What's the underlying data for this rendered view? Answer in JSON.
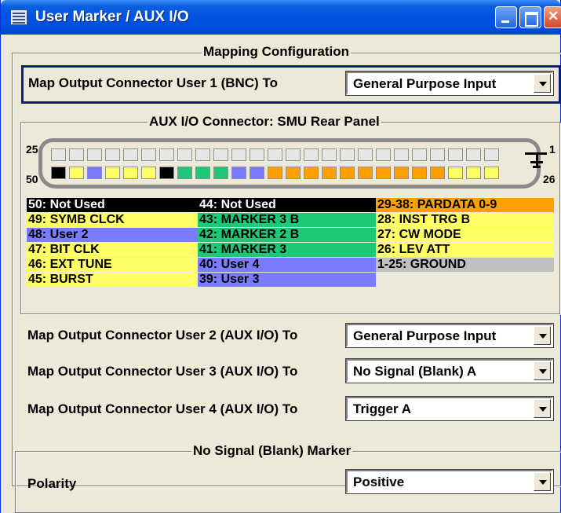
{
  "window": {
    "title": "User Marker / AUX I/O"
  },
  "mapping": {
    "group_title": "Mapping Configuration",
    "user1_label": "Map Output Connector User 1 (BNC) To",
    "user1_value": "General Purpose Input"
  },
  "aux": {
    "group_title": "AUX I/O Connector: SMU Rear Panel",
    "pin_labels": {
      "top_left": "25",
      "top_right": "1",
      "bottom_left": "50",
      "bottom_right": "26"
    },
    "top_row_colors": [
      "#e6e6e6",
      "#e6e6e6",
      "#e6e6e6",
      "#e6e6e6",
      "#e6e6e6",
      "#e6e6e6",
      "#e6e6e6",
      "#e6e6e6",
      "#e6e6e6",
      "#e6e6e6",
      "#e6e6e6",
      "#e6e6e6",
      "#e6e6e6",
      "#e6e6e6",
      "#e6e6e6",
      "#e6e6e6",
      "#e6e6e6",
      "#e6e6e6",
      "#e6e6e6",
      "#e6e6e6",
      "#e6e6e6",
      "#e6e6e6",
      "#e6e6e6",
      "#e6e6e6",
      "#e6e6e6"
    ],
    "bottom_row_colors": [
      "#000000",
      "#ffff66",
      "#7b7bff",
      "#ffff66",
      "#ffff66",
      "#ffff66",
      "#000000",
      "#1ec877",
      "#1ec877",
      "#1ec877",
      "#7b7bff",
      "#7b7bff",
      "#ff9f00",
      "#ff9f00",
      "#ff9f00",
      "#ff9f00",
      "#ff9f00",
      "#ff9f00",
      "#ff9f00",
      "#ff9f00",
      "#ff9f00",
      "#ff9f00",
      "#ffff66",
      "#ffff66",
      "#ffff66"
    ],
    "legend": [
      [
        {
          "text": "50: Not Used",
          "bg": "#000000",
          "fg": "#ffffff"
        },
        {
          "text": "44: Not Used",
          "bg": "#000000",
          "fg": "#ffffff"
        },
        {
          "text": "29-38: PARDATA 0-9",
          "bg": "#ff9f00",
          "fg": "#000000"
        }
      ],
      [
        {
          "text": "49: SYMB CLCK",
          "bg": "#ffff66",
          "fg": "#000000"
        },
        {
          "text": "43: MARKER 3 B",
          "bg": "#1ec877",
          "fg": "#000000"
        },
        {
          "text": "28: INST TRG B",
          "bg": "#ffff66",
          "fg": "#000000"
        }
      ],
      [
        {
          "text": "48: User 2",
          "bg": "#7b7bff",
          "fg": "#000000"
        },
        {
          "text": "42: MARKER 2 B",
          "bg": "#1ec877",
          "fg": "#000000"
        },
        {
          "text": "27: CW MODE",
          "bg": "#ffff66",
          "fg": "#000000"
        }
      ],
      [
        {
          "text": "47: BIT CLK",
          "bg": "#ffff66",
          "fg": "#000000"
        },
        {
          "text": "41: MARKER 3",
          "bg": "#1ec877",
          "fg": "#000000"
        },
        {
          "text": "26: LEV ATT",
          "bg": "#ffff66",
          "fg": "#000000"
        }
      ],
      [
        {
          "text": "46: EXT TUNE",
          "bg": "#ffff66",
          "fg": "#000000"
        },
        {
          "text": "40: User 4",
          "bg": "#7b7bff",
          "fg": "#000000"
        },
        {
          "text": "1-25: GROUND",
          "bg": "#c0c0c0",
          "fg": "#000000"
        }
      ],
      [
        {
          "text": "45: BURST",
          "bg": "#ffff66",
          "fg": "#000000"
        },
        {
          "text": "39: User 3",
          "bg": "#7b7bff",
          "fg": "#000000"
        },
        {
          "text": "",
          "bg": "#ece9d8",
          "fg": "#000000"
        }
      ]
    ]
  },
  "outputs": {
    "user2_label": "Map Output Connector User 2 (AUX I/O) To",
    "user2_value": "General Purpose Input",
    "user3_label": "Map Output Connector User 3 (AUX I/O) To",
    "user3_value": "No Signal (Blank) A",
    "user4_label": "Map Output Connector User 4 (AUX I/O) To",
    "user4_value": "Trigger A"
  },
  "blank_marker": {
    "group_title": "No Signal (Blank) Marker",
    "polarity_label": "Polarity",
    "polarity_value": "Positive"
  },
  "icons": {
    "window_icon": "dialog-icon",
    "minimize": "minimize-icon",
    "maximize": "maximize-icon",
    "close": "close-icon"
  }
}
